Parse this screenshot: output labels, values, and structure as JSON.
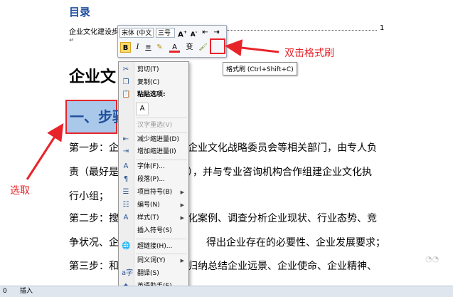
{
  "doc": {
    "toc_title": "目录",
    "toc_entry": "企业文化建设步",
    "toc_page": "1",
    "heading_part1": "企业文",
    "heading_part2": "骤",
    "heading2": "一、步骤",
    "lines": [
      {
        "left": "第一步：企",
        "right": "企业文化战略委员会等相关部门，由专人负"
      },
      {
        "left": "责（最好是",
        "right": "），并与专业咨询机构合作组建企业文化执"
      },
      {
        "left": "行小组；",
        "right": ""
      },
      {
        "left": "第二步：搜",
        "right": "化案例、调查分析企业现状、行业态势、竞"
      },
      {
        "left": "争状况、企",
        "right": "得出企业存在的必要性、企业发展要求；"
      },
      {
        "left": "第三步：和",
        "right": "归纳总结企业远景、企业使命、企业精神、"
      }
    ]
  },
  "mini_toolbar": {
    "font_name": "宋体 (中文",
    "font_size": "三号",
    "tooltip": "格式刷 (Ctrl+Shift+C)"
  },
  "context_menu": {
    "items": [
      {
        "label": "剪切(T)",
        "icon": "cut-icon"
      },
      {
        "label": "复制(C)",
        "icon": "copy-icon"
      },
      {
        "label": "粘贴选项:",
        "icon": "paste-icon"
      },
      {
        "label": "汉字重选(V)",
        "icon": "",
        "disabled": true
      },
      {
        "label": "减少缩进量(D)",
        "icon": "decrease-indent-icon"
      },
      {
        "label": "增加缩进量(I)",
        "icon": "increase-indent-icon"
      },
      {
        "label": "字体(F)...",
        "icon": "font-icon"
      },
      {
        "label": "段落(P)...",
        "icon": "paragraph-icon"
      },
      {
        "label": "项目符号(B)",
        "icon": "bullets-icon",
        "submenu": true
      },
      {
        "label": "编号(N)",
        "icon": "numbering-icon",
        "submenu": true
      },
      {
        "label": "样式(T)",
        "icon": "styles-icon",
        "submenu": true
      },
      {
        "label": "插入符号(S)",
        "icon": ""
      },
      {
        "label": "超链接(H)...",
        "icon": "hyperlink-icon"
      },
      {
        "label": "同义词(Y)",
        "icon": "",
        "submenu": true
      },
      {
        "label": "翻译(S)",
        "icon": "translate-icon"
      },
      {
        "label": "英语助手(E)",
        "icon": "english-assistant-icon"
      }
    ]
  },
  "annotations": {
    "double_click": "双击格式刷",
    "select": "选取"
  },
  "status_bar": {
    "left": "0",
    "insert": "插入"
  },
  "colors": {
    "annotation_red": "#e8242b",
    "heading_blue": "#1f4e9d",
    "selection": "#a9c8ea"
  }
}
